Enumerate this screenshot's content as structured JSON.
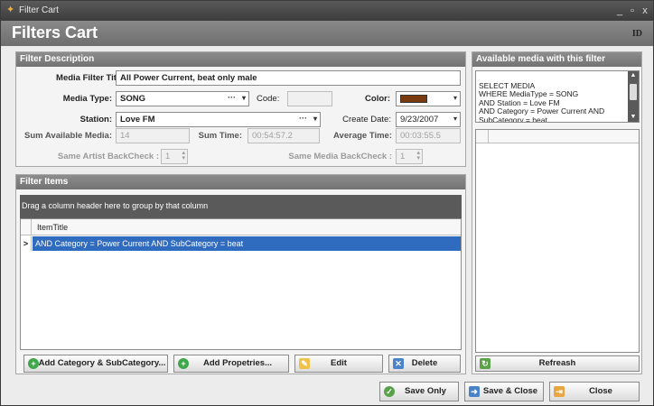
{
  "window": {
    "title": "Filter Cart",
    "icon": "app-icon",
    "minimize_glyph": "_",
    "maximize_glyph": "▫",
    "close_glyph": "x"
  },
  "banner": {
    "heading": "Filters Cart",
    "tag": "ID"
  },
  "filter_description": {
    "header": "Filter Description",
    "media_filter_title_label": "Media Filter Title:",
    "media_filter_title_value": "All Power Current, beat only male",
    "media_type_label": "Media Type:",
    "media_type_value": "SONG",
    "code_label": "Code:",
    "code_value": "",
    "color_label": "Color:",
    "color_value": "#7a3a10",
    "station_label": "Station:",
    "station_value": "Love FM",
    "create_date_label": "Create Date:",
    "create_date_value": "9/23/2007",
    "sum_available_media_label": "Sum Available Media:",
    "sum_available_media_value": "14",
    "sum_time_label": "Sum Time:",
    "sum_time_value": "00:54:57.2",
    "average_time_label": "Average Time:",
    "average_time_value": "00:03:55.5",
    "same_artist_label": "Same Artist BackCheck :",
    "same_artist_value": "1",
    "same_media_label": "Same Media BackCheck :",
    "same_media_value": "1"
  },
  "filter_items": {
    "header": "Filter Items",
    "group_hint": "Drag a column header here to group by that column",
    "column_header": "ItemTitle",
    "rows": [
      {
        "indicator": ">",
        "item_title": "AND Category  = Power Current AND SubCategory  = beat"
      }
    ],
    "add_category_button": "Add Category & SubCategory...",
    "add_properties_button": "Add Propetries...",
    "edit_button": "Edit",
    "delete_button": "Delete"
  },
  "available_media": {
    "header": "Available media with this filter",
    "query_text": "SELECT MEDIA\nWHERE MediaType = SONG\nAND Station = Love FM\nAND Category  = Power Current AND\nSubCategory  = beat",
    "refresh_button": "Refreash"
  },
  "footer": {
    "save_only_button": "Save Only",
    "save_close_button": "Save & Close",
    "close_button": "Close"
  },
  "colors": {
    "accent_blue": "#2f6bbf",
    "header_gray": "#7c7c7c",
    "swatch_brown": "#7a3a10"
  }
}
